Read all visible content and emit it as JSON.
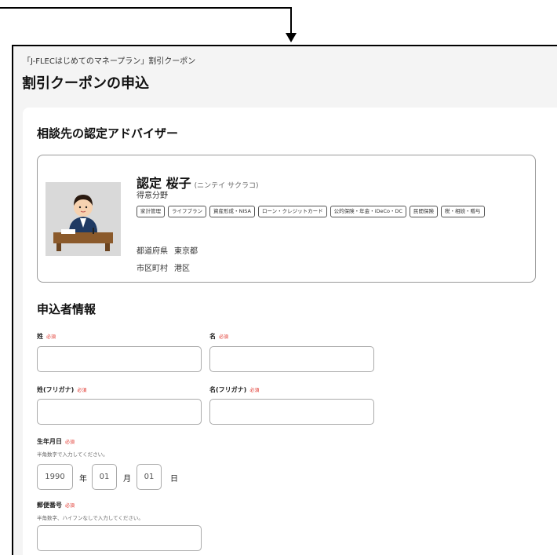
{
  "breadcrumb": "「J-FLECはじめてのマネープラン」割引クーポン",
  "page_title": "割引クーポンの申込",
  "advisor_section": {
    "title": "相談先の認定アドバイザー",
    "name": "認定 桜子",
    "kana": "(ニンテイ サクラコ)",
    "specialty_label": "得意分野",
    "tags": [
      "家計管理",
      "ライフプラン",
      "資産形成・NISA",
      "ローン・クレジットカード",
      "公的保険・年金・iDeCo・DC",
      "民間保険",
      "税・相続・贈与"
    ],
    "prefecture_label": "都道府県",
    "prefecture": "東京都",
    "city_label": "市区町村",
    "city": "港区"
  },
  "applicant_section": {
    "title": "申込者情報",
    "required": "必須",
    "last_name_label": "姓",
    "first_name_label": "名",
    "last_name_kana_label": "姓(フリガナ)",
    "first_name_kana_label": "名(フリガナ)",
    "birthdate_label": "生年月日",
    "birthdate_hint": "半角数字で入力してください。",
    "birth_year": "1990",
    "birth_month": "01",
    "birth_day": "01",
    "year_unit": "年",
    "month_unit": "月",
    "day_unit": "日",
    "postal_label": "郵便番号",
    "postal_hint": "半角数字、ハイフンなしで入力してください。"
  }
}
